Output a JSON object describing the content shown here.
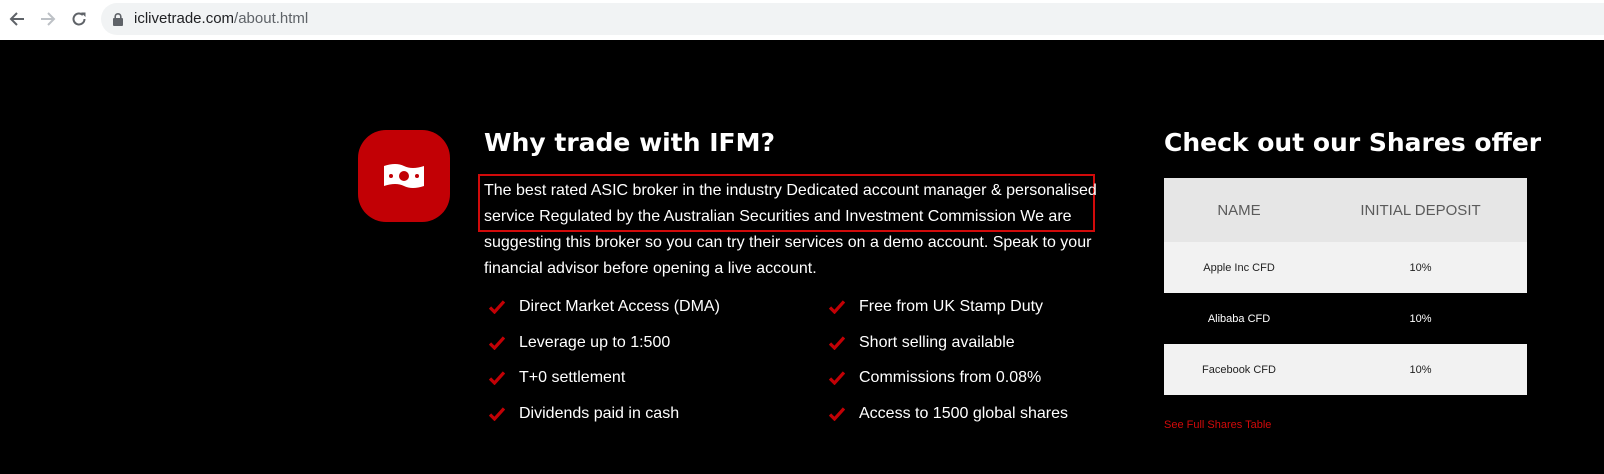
{
  "browser": {
    "url_host": "iclivetrade.com",
    "url_path": "/about.html"
  },
  "why": {
    "title": "Why trade with IFM?",
    "intro": "The best rated ASIC broker in the industry Dedicated account manager & personalised service Regulated by the Australian Securities and Investment Commission We are suggesting this broker so you can try their services on a demo account. Speak to your financial advisor before opening a live account.",
    "features_left": [
      "Direct Market Access (DMA)",
      "Leverage up to 1:500",
      "T+0 settlement",
      "Dividends paid in cash"
    ],
    "features_right": [
      "Free from UK Stamp Duty",
      "Short selling available",
      "Commissions from 0.08%",
      "Access to 1500 global shares"
    ]
  },
  "shares": {
    "title": "Check out our Shares offer",
    "columns": [
      "NAME",
      "INITIAL DEPOSIT"
    ],
    "rows": [
      {
        "name": "Apple Inc CFD",
        "deposit": "10%"
      },
      {
        "name": "Alibaba CFD",
        "deposit": "10%"
      },
      {
        "name": "Facebook CFD",
        "deposit": "10%"
      }
    ],
    "link": "See Full Shares Table"
  },
  "colors": {
    "accent_red": "#c20005",
    "highlight_border": "#d10a0a",
    "background": "#000000"
  },
  "icons": [
    "back-arrow-icon",
    "forward-arrow-icon",
    "reload-icon",
    "lock-icon",
    "banknote-icon",
    "checkmark-icon"
  ]
}
